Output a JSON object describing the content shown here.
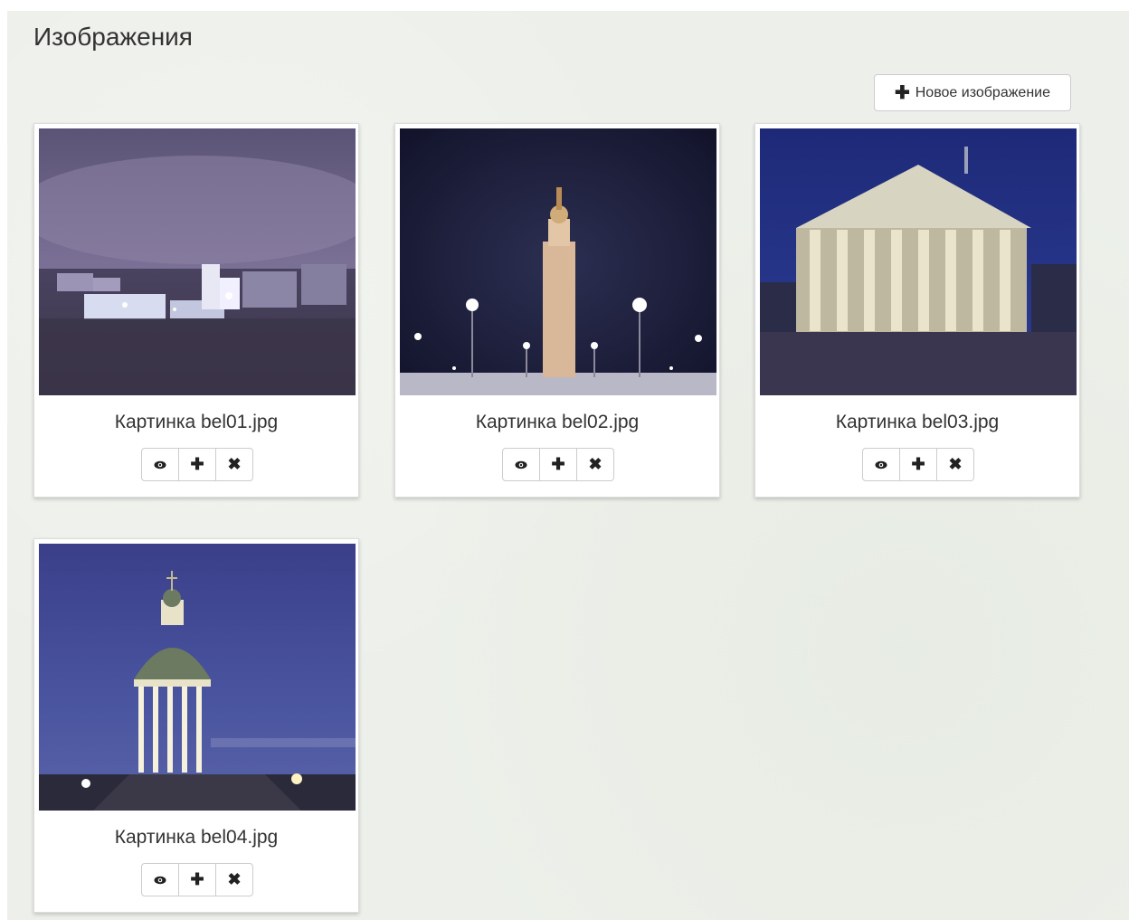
{
  "page": {
    "title": "Изображения",
    "new_button_label": "Новое изображение",
    "new_button_icon": "plus-icon"
  },
  "gallery": {
    "items": [
      {
        "caption": "Картинка bel01.jpg",
        "scene": "city-night-panorama"
      },
      {
        "caption": "Картинка bel02.jpg",
        "scene": "monument-column-night"
      },
      {
        "caption": "Картинка bel03.jpg",
        "scene": "theater-facade-night"
      },
      {
        "caption": "Картинка bel04.jpg",
        "scene": "chapel-rotunda-dusk"
      }
    ],
    "actions": [
      {
        "name": "view",
        "icon": "eye-icon"
      },
      {
        "name": "add",
        "icon": "plus-icon"
      },
      {
        "name": "delete",
        "icon": "close-icon"
      }
    ]
  },
  "colors": {
    "background": "#edf0ea",
    "card": "#ffffff",
    "border": "#cccccc",
    "text": "#333333"
  }
}
